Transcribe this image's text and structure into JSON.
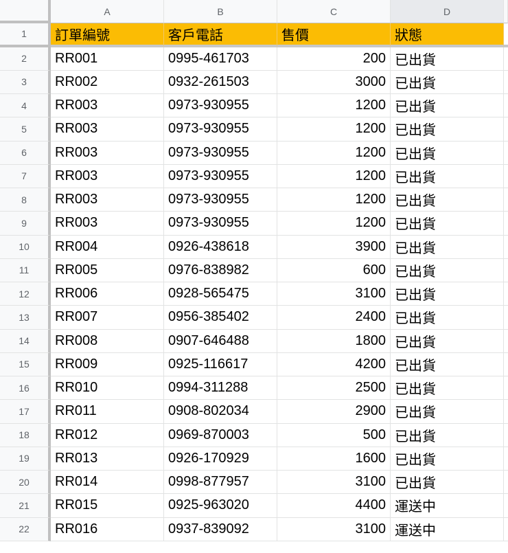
{
  "columns": [
    "A",
    "B",
    "C",
    "D"
  ],
  "header_row": {
    "row_number": "1",
    "cells": [
      "訂單編號",
      "客戶電話",
      "售價",
      "狀態"
    ],
    "fill_color": "#fbbc04"
  },
  "rows": [
    {
      "n": "2",
      "order": "RR001",
      "phone": "0995-461703",
      "price": "200",
      "status": "已出貨"
    },
    {
      "n": "3",
      "order": "RR002",
      "phone": "0932-261503",
      "price": "3000",
      "status": "已出貨"
    },
    {
      "n": "4",
      "order": "RR003",
      "phone": "0973-930955",
      "price": "1200",
      "status": "已出貨"
    },
    {
      "n": "5",
      "order": "RR003",
      "phone": "0973-930955",
      "price": "1200",
      "status": "已出貨"
    },
    {
      "n": "6",
      "order": "RR003",
      "phone": "0973-930955",
      "price": "1200",
      "status": "已出貨"
    },
    {
      "n": "7",
      "order": "RR003",
      "phone": "0973-930955",
      "price": "1200",
      "status": "已出貨"
    },
    {
      "n": "8",
      "order": "RR003",
      "phone": "0973-930955",
      "price": "1200",
      "status": "已出貨"
    },
    {
      "n": "9",
      "order": "RR003",
      "phone": "0973-930955",
      "price": "1200",
      "status": "已出貨"
    },
    {
      "n": "10",
      "order": "RR004",
      "phone": "0926-438618",
      "price": "3900",
      "status": "已出貨"
    },
    {
      "n": "11",
      "order": "RR005",
      "phone": "0976-838982",
      "price": "600",
      "status": "已出貨"
    },
    {
      "n": "12",
      "order": "RR006",
      "phone": "0928-565475",
      "price": "3100",
      "status": "已出貨"
    },
    {
      "n": "13",
      "order": "RR007",
      "phone": "0956-385402",
      "price": "2400",
      "status": "已出貨"
    },
    {
      "n": "14",
      "order": "RR008",
      "phone": "0907-646488",
      "price": "1800",
      "status": "已出貨"
    },
    {
      "n": "15",
      "order": "RR009",
      "phone": "0925-116617",
      "price": "4200",
      "status": "已出貨"
    },
    {
      "n": "16",
      "order": "RR010",
      "phone": "0994-311288",
      "price": "2500",
      "status": "已出貨"
    },
    {
      "n": "17",
      "order": "RR011",
      "phone": "0908-802034",
      "price": "2900",
      "status": "已出貨"
    },
    {
      "n": "18",
      "order": "RR012",
      "phone": "0969-870003",
      "price": "500",
      "status": "已出貨"
    },
    {
      "n": "19",
      "order": "RR013",
      "phone": "0926-170929",
      "price": "1600",
      "status": "已出貨"
    },
    {
      "n": "20",
      "order": "RR014",
      "phone": "0998-877957",
      "price": "3100",
      "status": "已出貨"
    },
    {
      "n": "21",
      "order": "RR015",
      "phone": "0925-963020",
      "price": "4400",
      "status": "運送中"
    },
    {
      "n": "22",
      "order": "RR016",
      "phone": "0937-839092",
      "price": "3100",
      "status": "運送中"
    }
  ]
}
